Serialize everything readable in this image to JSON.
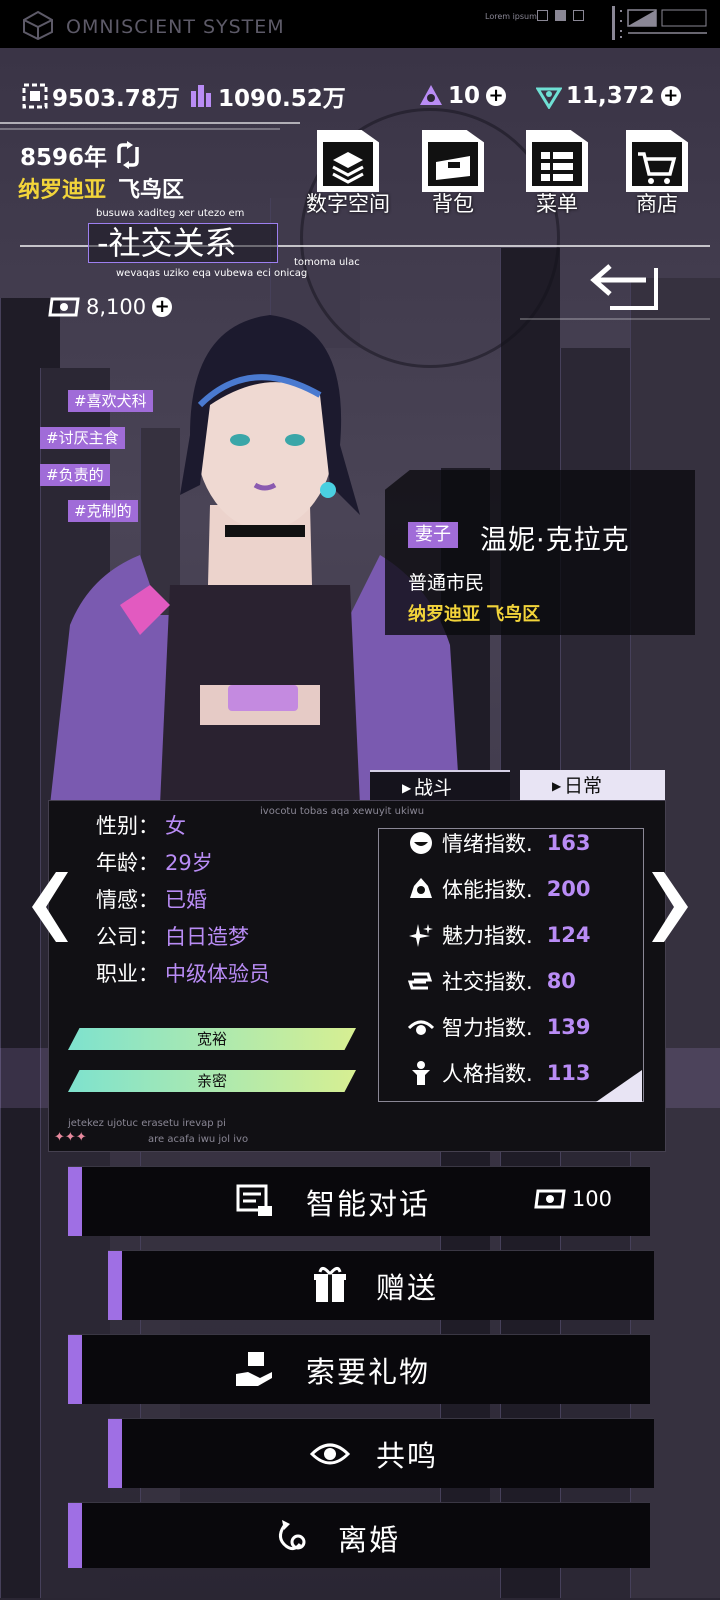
{
  "system": {
    "title": "OMNISCIENT SYSTEM",
    "lorem": "Lorem ipsum"
  },
  "currency": {
    "a": "9503.78万",
    "b": "1090.52万",
    "c": "10",
    "d": "11,372"
  },
  "year": "8596年",
  "district": {
    "city": "纳罗迪亚",
    "area": "飞鸟区"
  },
  "nav": [
    "数字空间",
    "背包",
    "菜单",
    "商店"
  ],
  "section": {
    "title": "-社交关系",
    "small_top": "busuwa xaditeg xer utezo em",
    "small_bottom": "wevaqas uziko eqa vubewa eci onicag",
    "small_right": "tomoma ulac"
  },
  "coins": "8,100",
  "tags": [
    "#喜欢犬科",
    "#讨厌主食",
    "#负责的",
    "#克制的"
  ],
  "character": {
    "relation": "妻子",
    "name": "温妮·克拉克",
    "occupation": "普通市民",
    "location": "纳罗迪亚 飞鸟区"
  },
  "tabs": {
    "combat": "战斗",
    "daily": "日常"
  },
  "panel_text": {
    "top": "ivocotu tobas aqa xewuyit ukiwu",
    "bottom1": "jetekez ujotuc erasetu irevap pi",
    "bottom2": "are acafa iwu jol ivo",
    "stars": "✦✦✦"
  },
  "info": [
    {
      "key": "性别：",
      "value": "女"
    },
    {
      "key": "年龄：",
      "value": "29岁"
    },
    {
      "key": "情感：",
      "value": "已婚"
    },
    {
      "key": "公司：",
      "value": "白日造梦"
    },
    {
      "key": "职业：",
      "value": "中级体验员"
    }
  ],
  "bars": [
    {
      "label": "宽裕",
      "fill": 1.0
    },
    {
      "label": "亲密",
      "fill": 1.0
    }
  ],
  "stats": [
    {
      "label": "情绪指数.",
      "value": "163",
      "icon": "smile-icon"
    },
    {
      "label": "体能指数.",
      "value": "200",
      "icon": "fitness-icon"
    },
    {
      "label": "魅力指数.",
      "value": "124",
      "icon": "sparkle-icon"
    },
    {
      "label": "社交指数.",
      "value": "80",
      "icon": "social-icon"
    },
    {
      "label": "智力指数.",
      "value": "139",
      "icon": "eye-icon"
    },
    {
      "label": "人格指数.",
      "value": "113",
      "icon": "person-icon"
    }
  ],
  "actions": {
    "chat": "智能对话",
    "chat_cost": "100",
    "gift": "赠送",
    "ask_gift": "索要礼物",
    "resonate": "共鸣",
    "divorce": "离婚"
  },
  "colors": {
    "accent": "#9f6fe4",
    "yellow": "#f2d43a",
    "value": "#b98cf5",
    "bar_start": "#7ee2ce",
    "bar_end": "#d7ef92"
  }
}
